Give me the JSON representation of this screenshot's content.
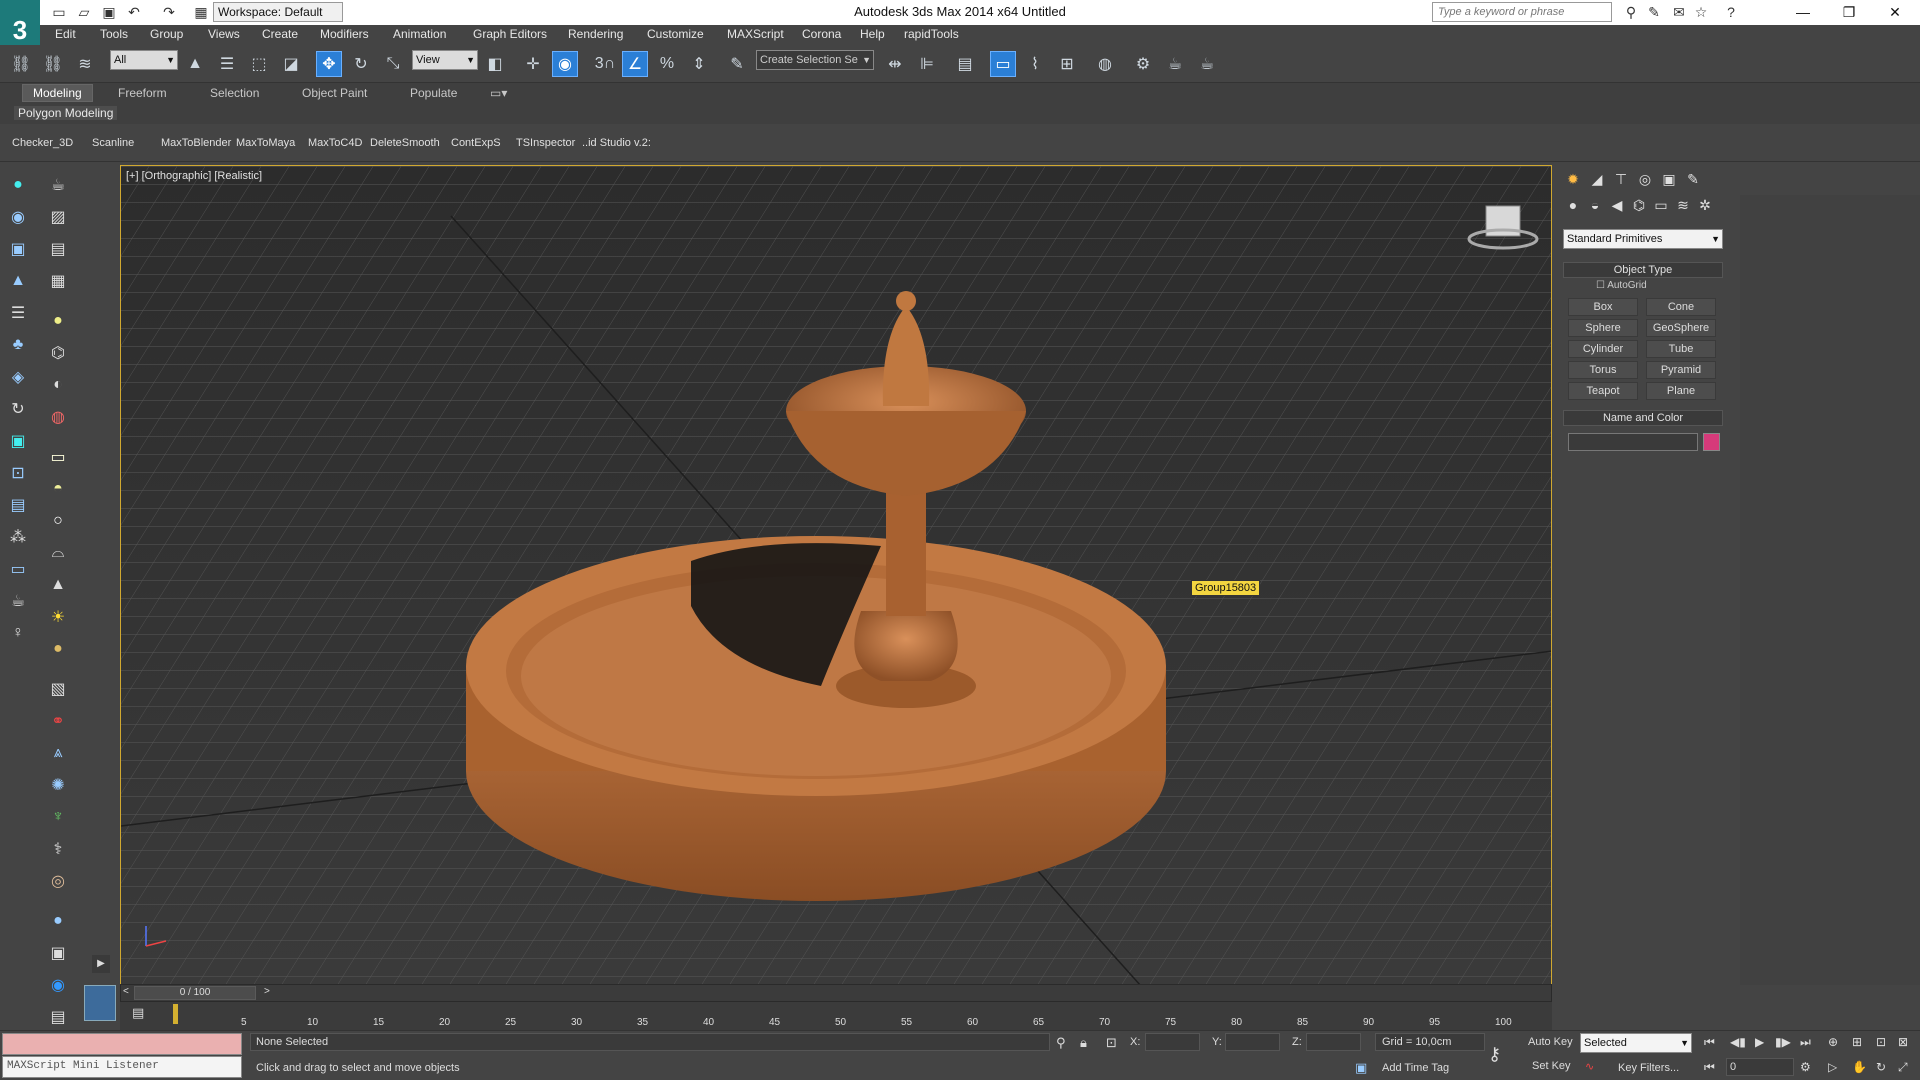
{
  "titlebar": {
    "title": "Autodesk 3ds Max  2014 x64      Untitled",
    "workspace": "Workspace: Default",
    "search_placeholder": "Type a keyword or phrase",
    "logo": "3"
  },
  "menu": [
    "Edit",
    "Tools",
    "Group",
    "Views",
    "Create",
    "Modifiers",
    "Animation",
    "Graph Editors",
    "Rendering",
    "Customize",
    "MAXScript",
    "Corona",
    "Help",
    "rapidTools"
  ],
  "toolbar": {
    "selection_filter": "All",
    "ref_coord": "View",
    "selection_set": "Create Selection Se",
    "snap_label": "3"
  },
  "ribbon": {
    "tabs": [
      "Modeling",
      "Freeform",
      "Selection",
      "Object Paint",
      "Populate"
    ],
    "active_tab": "Modeling",
    "panel": "Polygon Modeling"
  },
  "scriptbar": [
    "Checker_3D",
    "Scanline",
    "MaxToBlender",
    "MaxToMaya",
    "MaxToC4D",
    "DeleteSmooth",
    "ContExpS",
    "TSInspector",
    "..id Studio v.2:"
  ],
  "viewport": {
    "label": "[+] [Orthographic] [Realistic]",
    "group_tag": "Group15803"
  },
  "cmdpanel": {
    "category": "Standard Primitives",
    "object_type_title": "Object Type",
    "autogrid": "AutoGrid",
    "primitives": [
      "Box",
      "Cone",
      "Sphere",
      "GeoSphere",
      "Cylinder",
      "Tube",
      "Torus",
      "Pyramid",
      "Teapot",
      "Plane"
    ],
    "name_color_title": "Name and Color",
    "color_swatch": "#d63a7a"
  },
  "timeline": {
    "frame_display": "0 / 100",
    "ticks": [
      "5",
      "10",
      "15",
      "20",
      "25",
      "30",
      "35",
      "40",
      "45",
      "50",
      "55",
      "60",
      "65",
      "70",
      "75",
      "80",
      "85",
      "90",
      "95",
      "100"
    ]
  },
  "status": {
    "listener": "MAXScript Mini Listener",
    "selection": "None Selected",
    "prompt": "Click and drag to select and move objects",
    "x_label": "X:",
    "y_label": "Y:",
    "z_label": "Z:",
    "grid": "Grid = 10,0cm",
    "add_time_tag": "Add Time Tag",
    "auto_key": "Auto Key",
    "set_key": "Set Key",
    "key_mode": "Selected",
    "key_filters": "Key Filters...",
    "frame": "0"
  },
  "colors": {
    "accent": "#2b7fd6",
    "viewport_border": "#d0a830",
    "object": "#c47a45"
  }
}
